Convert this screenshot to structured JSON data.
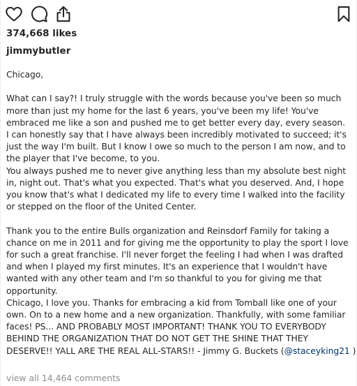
{
  "actions": {
    "like_icon": "heart-outline-icon",
    "comment_icon": "speech-bubble-icon",
    "share_icon": "share-upload-icon",
    "save_icon": "bookmark-icon"
  },
  "post": {
    "likes_text": "374,668 likes",
    "username": "jimmybutler",
    "caption": {
      "l01": "Chicago,",
      "l02": "What can I say?! I truly struggle with the words because you've been so much",
      "l03": "more than just my home for the last 6 years, you've been my life! You've",
      "l04": "embraced me like a son and pushed me to get better every day, every season.",
      "l05": "I can honestly say that I have always been incredibly motivated to succeed; it's",
      "l06": "just the way I'm built. But I know I owe so much to the person I am now, and to",
      "l07": "the player that I've become, to you.",
      "l08": "You always pushed me to never give anything less than my absolute best night",
      "l09": "in, night out. That's what you expected. That's what you deserved. And, I hope",
      "l10": "you know that's what I dedicated my life to every time I walked into the facility",
      "l11": "or stepped on the floor of the United Center.",
      "l12": "Thank you to the entire Bulls organization and Reinsdorf Family for taking a",
      "l13": "chance on me in 2011 and for giving me the opportunity to play the sport I love",
      "l14": "for such a great franchise. I'll never forget the feeling I had when I was drafted",
      "l15": "and when I played my first minutes. It's an experience that I wouldn't have",
      "l16": "wanted with any other team and I'm so thankful to you for giving me that",
      "l17": "opportunity.",
      "l18": "Chicago, I love you. Thanks for embracing a kid from Tomball like one of your",
      "l19": "own. On to a new home and a new organization. Thankfully, with some familiar",
      "l20": "faces! PS... AND PROBABLY MOST IMPORTANT! THANK YOU TO EVERYBODY",
      "l21": "BEHIND THE ORGANIZATION THAT DO NOT GET THE SHINE THAT THEY",
      "l22_prefix": "DESERVE!! YALL ARE THE REAL ALL-STARS!! - Jimmy G. Buckets (",
      "l22_mention": "@staceyking21",
      "l22_suffix": " )"
    },
    "view_comments": "view all 14,464 comments"
  },
  "colors": {
    "text": "#262626",
    "muted": "#8e8e8e",
    "link": "#003569"
  }
}
